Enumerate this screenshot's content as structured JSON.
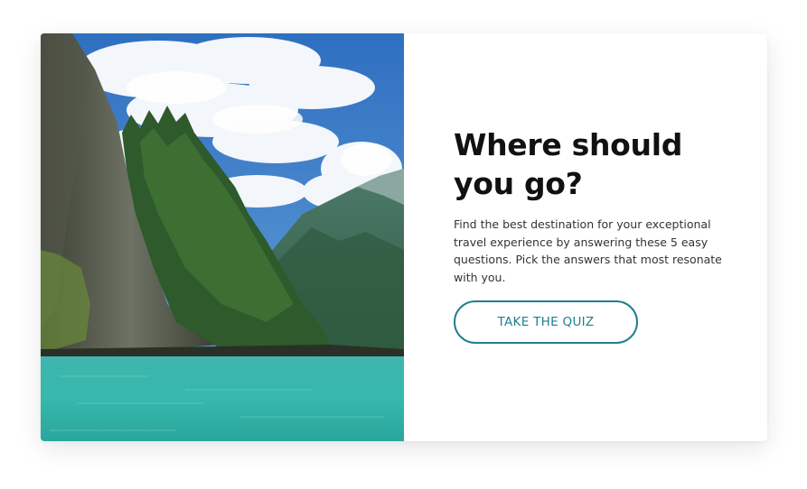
{
  "promo": {
    "title": "Where should you go?",
    "description": "Find the best destination for your exceptional travel experience by answering these 5 easy questions. Pick the answers that most resonate with you.",
    "cta_label": "TAKE THE QUIZ",
    "accent_color": "#1f7f8e"
  },
  "image": {
    "subject": "fjord-landscape-photo"
  }
}
